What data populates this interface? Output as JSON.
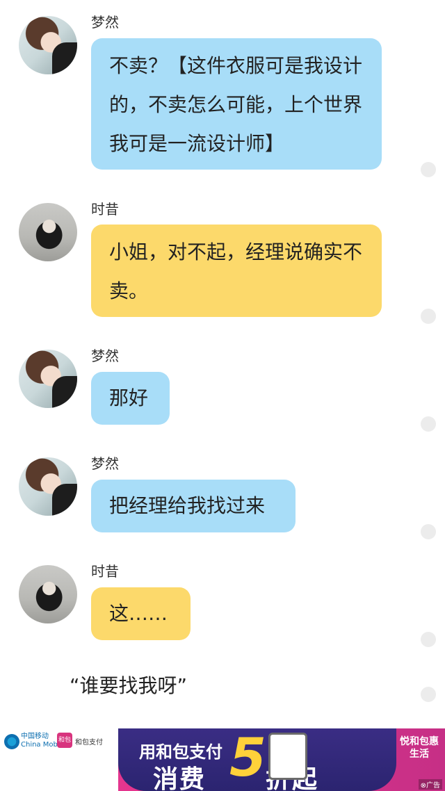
{
  "messages": [
    {
      "sender": "梦然",
      "text": "不卖？【这件衣服可是我设计的，不卖怎么可能，上个世界我可是一流设计师】",
      "color": "#a8ddf8"
    },
    {
      "sender": "时昔",
      "text": "小姐，对不起，经理说确实不卖。",
      "color": "#fcd96b"
    },
    {
      "sender": "梦然",
      "text": "那好",
      "color": "#a8ddf8"
    },
    {
      "sender": "梦然",
      "text": "把经理给我找过来",
      "color": "#a8ddf8"
    },
    {
      "sender": "时昔",
      "text": "这……",
      "color": "#fcd96b"
    }
  ],
  "narration": "“谁要找我呀”",
  "ad": {
    "china_mobile": "中国移动",
    "china_mobile_en": "China Mobile",
    "hebao": "和包支付",
    "line1": "用和包支付",
    "line2": "消费",
    "big_number": "5",
    "line2_suffix": "折起",
    "right_badge": "悦和包惠生活",
    "tag": "广告"
  }
}
